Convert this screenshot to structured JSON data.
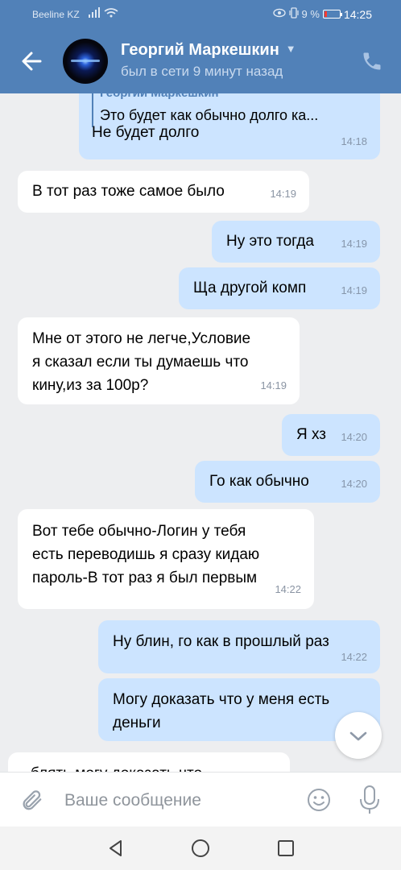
{
  "status_bar": {
    "carrier": "Beeline KZ",
    "battery": "9 %",
    "time": "14:25"
  },
  "header": {
    "contact_name": "Георгий Маркешкин",
    "last_seen": "был в сети 9 минут назад"
  },
  "messages": [
    {
      "dir": "out",
      "reply_to": {
        "author": "Георгий Маркешкин",
        "text": "Это будет как обычно долго ка..."
      },
      "text": "Не будет долго",
      "time": "14:18"
    },
    {
      "dir": "in",
      "text": "В тот раз тоже самое было",
      "time": "14:19"
    },
    {
      "dir": "out",
      "text": "Ну это тогда",
      "time": "14:19"
    },
    {
      "dir": "out",
      "text": "Ща другой комп",
      "time": "14:19"
    },
    {
      "dir": "in",
      "text": "Мне от этого не легче,Условие\nя сказал если ты думаешь что\nкину,из за 100р?",
      "time": "14:19"
    },
    {
      "dir": "out",
      "text": "Я хз",
      "time": "14:20"
    },
    {
      "dir": "out",
      "text": "Го как обычно",
      "time": "14:20"
    },
    {
      "dir": "in",
      "text": "Вот тебе обычно-Логин у тебя\nесть переводишь я сразу кидаю\nпароль-В тот раз я был первым",
      "time": "14:22"
    },
    {
      "dir": "out",
      "text": "Ну блин, го как в прошлый раз",
      "time": "14:22"
    },
    {
      "dir": "out",
      "text": "Могу доказать что у меня есть\nденьги",
      "time": ""
    },
    {
      "dir": "in",
      "text": "блять могу доказать что",
      "time": ""
    }
  ],
  "composer": {
    "placeholder": "Ваше сообщение"
  },
  "colors": {
    "header": "#5181b8",
    "outgoing_bubble": "#cce4ff",
    "incoming_bubble": "#ffffff",
    "background": "#edeef0"
  }
}
